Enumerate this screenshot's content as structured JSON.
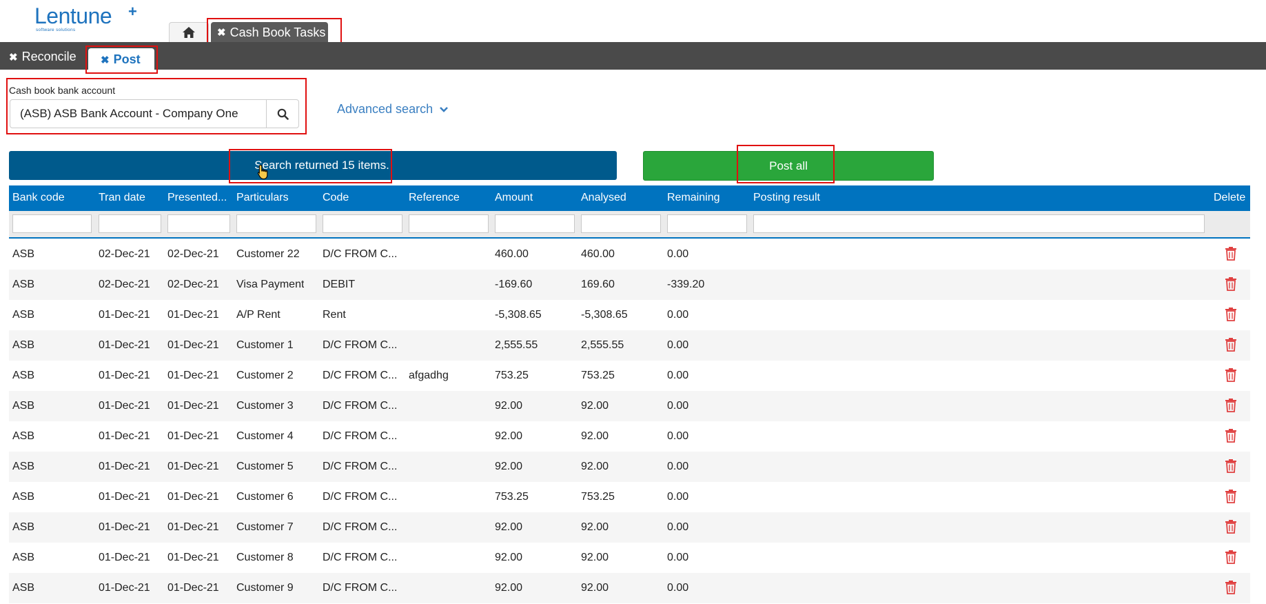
{
  "logo": {
    "word": "Lentune",
    "plus": "+",
    "tagline": "software solutions"
  },
  "top_tabs": {
    "home_icon": "home-icon",
    "cashbook_label": "Cash Book Tasks",
    "close_glyph": "✖"
  },
  "sub_tabs": {
    "reconcile_label": "Reconcile",
    "post_label": "Post"
  },
  "search": {
    "label": "Cash book bank account",
    "value": "(ASB) ASB Bank Account - Company One",
    "button_icon": "search-icon",
    "advanced_label": "Advanced search"
  },
  "banner": {
    "message": "Search returned 15 items."
  },
  "actions": {
    "post_all_label": "Post all"
  },
  "table": {
    "headers": [
      "Bank code",
      "Tran date",
      "Presented...",
      "Particulars",
      "Code",
      "Reference",
      "Amount",
      "Analysed",
      "Remaining",
      "Posting result",
      "Delete"
    ],
    "rows": [
      [
        "ASB",
        "02-Dec-21",
        "02-Dec-21",
        "Customer 22",
        "D/C FROM C...",
        "",
        "460.00",
        "460.00",
        "0.00",
        ""
      ],
      [
        "ASB",
        "02-Dec-21",
        "02-Dec-21",
        "Visa Payment",
        "DEBIT",
        "",
        "-169.60",
        "169.60",
        "-339.20",
        ""
      ],
      [
        "ASB",
        "01-Dec-21",
        "01-Dec-21",
        "A/P Rent",
        "Rent",
        "",
        "-5,308.65",
        "-5,308.65",
        "0.00",
        ""
      ],
      [
        "ASB",
        "01-Dec-21",
        "01-Dec-21",
        "Customer 1",
        "D/C FROM C...",
        "",
        "2,555.55",
        "2,555.55",
        "0.00",
        ""
      ],
      [
        "ASB",
        "01-Dec-21",
        "01-Dec-21",
        "Customer 2",
        "D/C FROM C...",
        "afgadhg",
        "753.25",
        "753.25",
        "0.00",
        ""
      ],
      [
        "ASB",
        "01-Dec-21",
        "01-Dec-21",
        "Customer 3",
        "D/C FROM C...",
        "",
        "92.00",
        "92.00",
        "0.00",
        ""
      ],
      [
        "ASB",
        "01-Dec-21",
        "01-Dec-21",
        "Customer 4",
        "D/C FROM C...",
        "",
        "92.00",
        "92.00",
        "0.00",
        ""
      ],
      [
        "ASB",
        "01-Dec-21",
        "01-Dec-21",
        "Customer 5",
        "D/C FROM C...",
        "",
        "92.00",
        "92.00",
        "0.00",
        ""
      ],
      [
        "ASB",
        "01-Dec-21",
        "01-Dec-21",
        "Customer 6",
        "D/C FROM C...",
        "",
        "753.25",
        "753.25",
        "0.00",
        ""
      ],
      [
        "ASB",
        "01-Dec-21",
        "01-Dec-21",
        "Customer 7",
        "D/C FROM C...",
        "",
        "92.00",
        "92.00",
        "0.00",
        ""
      ],
      [
        "ASB",
        "01-Dec-21",
        "01-Dec-21",
        "Customer 8",
        "D/C FROM C...",
        "",
        "92.00",
        "92.00",
        "0.00",
        ""
      ],
      [
        "ASB",
        "01-Dec-21",
        "01-Dec-21",
        "Customer 9",
        "D/C FROM C...",
        "",
        "92.00",
        "92.00",
        "0.00",
        ""
      ]
    ],
    "row_action_icon": "trash-icon"
  },
  "colors": {
    "brand": "#1e73be",
    "toolbar": "#4a4a4a",
    "banner": "#005a8c",
    "post_all": "#2aa63b",
    "table_header": "#0073bf",
    "delete": "#e04040",
    "highlight": "#e01010"
  }
}
